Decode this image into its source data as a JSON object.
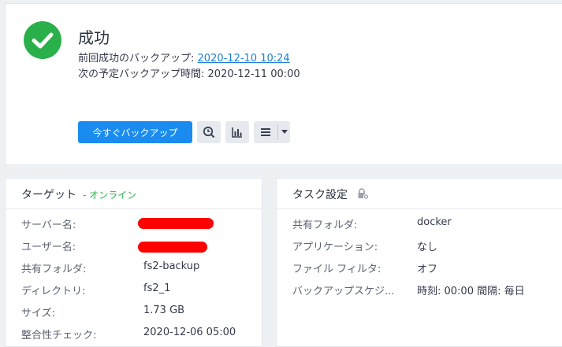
{
  "status": {
    "title": "成功",
    "last_backup_label": "前回成功のバックアップ:",
    "last_backup_value": "2020-12-10 10:24",
    "next_backup_label": "次の予定バックアップ時間:",
    "next_backup_value": "2020-12-11 00:00",
    "icon": "check-circle-icon",
    "color": "#2ab04a"
  },
  "toolbar": {
    "backup_now_label": "今すぐバックアップ",
    "accent": "#1a8cf0"
  },
  "target": {
    "title": "ターゲット",
    "status": "- オンライン",
    "rows": [
      {
        "label": "サーバー名:",
        "value": ""
      },
      {
        "label": "ユーザー名:",
        "value": ""
      },
      {
        "label": "共有フォルダ:",
        "value": "fs2-backup"
      },
      {
        "label": "ディレクトリ:",
        "value": "fs2_1"
      },
      {
        "label": "サイズ:",
        "value": "1.73 GB"
      },
      {
        "label": "整合性チェック:",
        "value": "2020-12-06 05:00"
      }
    ]
  },
  "task": {
    "title": "タスク設定",
    "rows": [
      {
        "label": "共有フォルダ:",
        "value": "docker"
      },
      {
        "label": "アプリケーション:",
        "value": "なし"
      },
      {
        "label": "ファイル フィルタ:",
        "value": "オフ"
      },
      {
        "label": "バックアップスケジ...",
        "value": "時刻: 00:00 間隔: 毎日"
      }
    ]
  }
}
